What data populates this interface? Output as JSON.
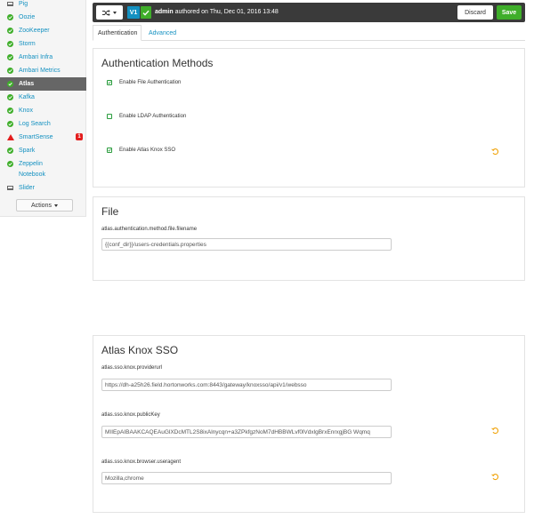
{
  "sidebar": {
    "items": [
      {
        "label": "Pig",
        "status": "laptop"
      },
      {
        "label": "Oozie",
        "status": "ok"
      },
      {
        "label": "ZooKeeper",
        "status": "ok"
      },
      {
        "label": "Storm",
        "status": "ok"
      },
      {
        "label": "Ambari Infra",
        "status": "ok"
      },
      {
        "label": "Ambari Metrics",
        "status": "ok"
      },
      {
        "label": "Atlas",
        "status": "ok",
        "active": true
      },
      {
        "label": "Kafka",
        "status": "ok"
      },
      {
        "label": "Knox",
        "status": "ok"
      },
      {
        "label": "Log Search",
        "status": "ok"
      },
      {
        "label": "SmartSense",
        "status": "warn",
        "badge": "1"
      },
      {
        "label": "Spark",
        "status": "ok"
      },
      {
        "label": "Zeppelin",
        "status": "ok"
      },
      {
        "label": "Notebook",
        "status": "none"
      },
      {
        "label": "Slider",
        "status": "laptop"
      }
    ],
    "actions_label": "Actions"
  },
  "topbar": {
    "version": "V1",
    "author": "admin",
    "authored_text": "authored on Thu, Dec 01, 2016 13:48",
    "discard_label": "Discard",
    "save_label": "Save"
  },
  "tabs": {
    "authentication": "Authentication",
    "advanced": "Advanced"
  },
  "auth_methods": {
    "title": "Authentication Methods",
    "options": [
      {
        "label": "Enable File Authentication",
        "checked": true
      },
      {
        "label": "Enable LDAP Authentication",
        "checked": false
      },
      {
        "label": "Enable Atlas Knox SSO",
        "checked": true
      }
    ]
  },
  "file_panel": {
    "title": "File",
    "field_label": "atlas.authentication.method.file.filename",
    "field_value": "{{conf_dir}}/users-credentials.properties"
  },
  "knox_panel": {
    "title": "Atlas Knox SSO",
    "fields": [
      {
        "label": "atlas.sso.knox.providerurl",
        "value": "https://dh-a25h26.field.hortonworks.com:8443/gateway/knoxsso/api/v1/websso"
      },
      {
        "label": "atlas.sso.knox.publicKey",
        "value": "MIIEpAIBAAKCAQEAuGlXDcMTL2S8ixAlnycqn+a3ZPkfgzNoM7dHBBWLvf0lVdxlgBrxEnrxgjBG Wqmq"
      },
      {
        "label": "atlas.sso.knox.browser.useragent",
        "value": "Mozilla,chrome"
      }
    ]
  },
  "colors": {
    "accent": "#1491c1",
    "ok": "#3fae2a",
    "warn": "#e31d1d",
    "undo": "#f0a30a"
  }
}
